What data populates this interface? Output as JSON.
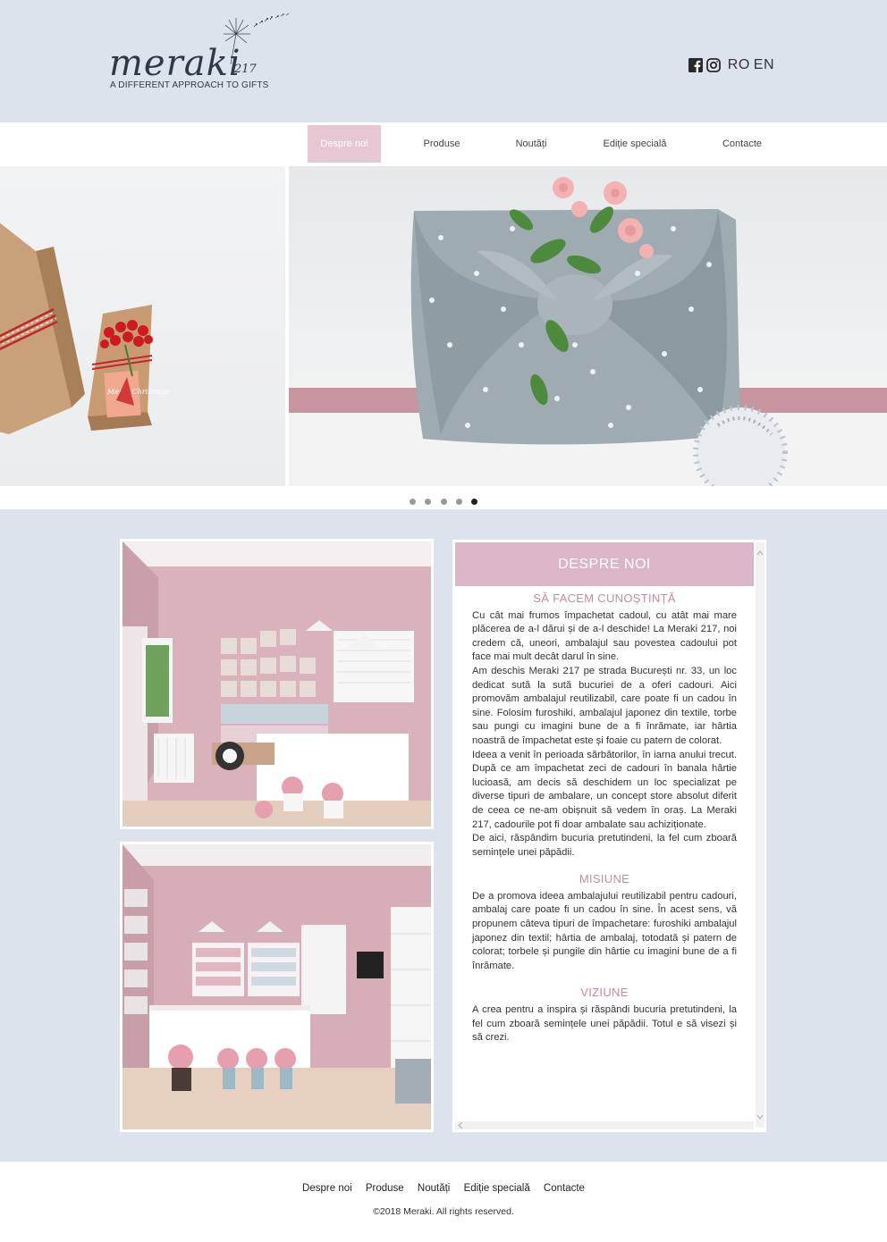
{
  "brand": {
    "name": "meraki",
    "number": "217",
    "tagline": "A DIFFERENT APPROACH TO GIFTS"
  },
  "header": {
    "languages": [
      "RO",
      "EN"
    ]
  },
  "nav": {
    "items": [
      "Despre noi",
      "Produse",
      "Noutăți",
      "Ediție specială",
      "Contacte"
    ],
    "active": "Despre noi"
  },
  "slider": {
    "slide_count": 5,
    "active_slide": 5,
    "left_slide_text": "Merry Christmas"
  },
  "about": {
    "title": "DESPRE NOI",
    "sections": [
      {
        "heading": "SĂ FACEM CUNOȘTINȚĂ",
        "paragraphs": [
          "Cu cât mai frumos împachetat cadoul, cu atât mai mare plăcerea de a-l dărui și de a-l deschide! La Meraki 217, noi credem că, uneori, ambalajul sau povestea cadoului pot face mai mult decât darul în sine.",
          "Am deschis Meraki 217 pe strada București nr. 33, un loc dedicat sută la sută bucuriei de a oferi cadouri. Aici promovăm ambalajul reutilizabil, care poate fi un cadou în sine. Folosim furoshiki, ambalajul japonez din textile, torbe sau pungi cu imagini bune de a fi înrămate, iar hârtia noastră de împachetat este și foaie cu patern de colorat.",
          "Ideea a venit în perioada sărbătorilor, în iarna anului trecut. După ce am împachetat zeci de cadouri în banala hârtie lucioasă, am decis să deschidem un loc specializat pe diverse tipuri de ambalare, un concept store absolut diferit de ceea ce ne-am obișnuit să vedem în oraș. La Meraki 217, cadourile pot fi doar ambalate sau achiziționate.",
          "De aici, răspândim bucuria pretutindeni, la fel cum zboară semințele unei păpădii."
        ]
      },
      {
        "heading": "MISIUNE",
        "paragraphs": [
          "De a promova ideea ambalajului reutilizabil pentru cadouri, ambalaj care poate fi un cadou în sine. În acest sens, vă propunem câteva tipuri de împachetare: furoshiki ambalajul japonez din textil; hârtia de ambalaj, totodată și patern de colorat; torbele și pungile din hârtie cu imagini bune de a fi înrămate."
        ]
      },
      {
        "heading": "VIZIUNE",
        "paragraphs": [
          "A crea pentru a inspira și răspândi bucuria pretutindeni, la fel cum zboară semințele unei păpădii. Totul e să visezi și să crezi."
        ]
      }
    ]
  },
  "footer": {
    "links": [
      "Despre noi",
      "Produse",
      "Noutăți",
      "Ediție specială",
      "Contacte"
    ],
    "copyright": "©2018 Meraki. All rights reserved."
  },
  "colors": {
    "page_bg": "#dce3ec",
    "nav_active": "#e6c7d3",
    "panel_title_bg": "#dab6c8",
    "section_heading": "#c48aa6"
  },
  "icons": [
    "facebook-icon",
    "instagram-icon",
    "dandelion-icon"
  ]
}
